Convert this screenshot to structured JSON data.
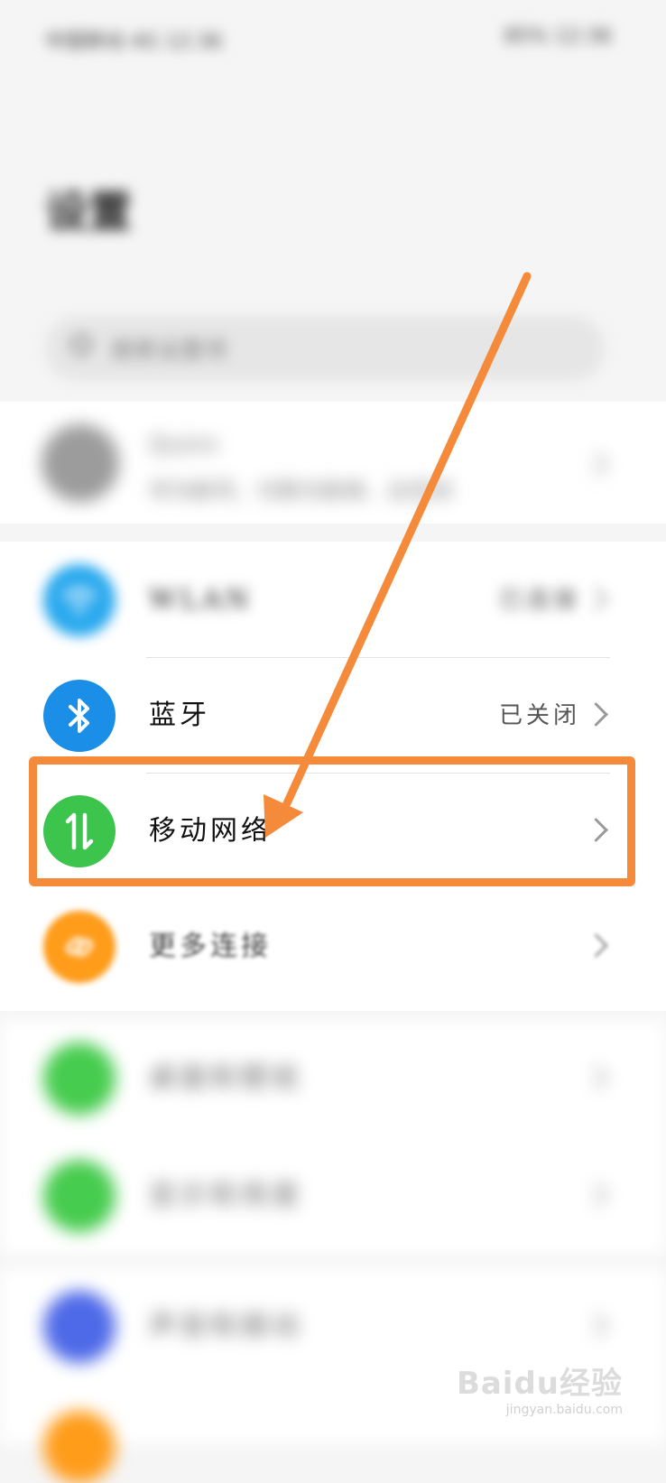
{
  "status_bar": {
    "left": "中国移动 4G 12:36",
    "right": "85% 12:36"
  },
  "page": {
    "title": "设置"
  },
  "search": {
    "placeholder": "搜索设置项"
  },
  "profile": {
    "name": "Quinn",
    "subtitle": "华为帐号、付款与账单、云空间"
  },
  "settings": {
    "wlan": {
      "label": "WLAN",
      "value": "已连接"
    },
    "bluetooth": {
      "label": "蓝牙",
      "value": "已关闭"
    },
    "mobile_network": {
      "label": "移动网络"
    },
    "more_connections": {
      "label": "更多连接"
    },
    "home_screen": {
      "label": "桌面和壁纸"
    },
    "display": {
      "label": "显示和亮度"
    },
    "sounds": {
      "label": "声音和振动"
    }
  },
  "icons": {
    "wlan": "wifi-icon",
    "bluetooth": "bluetooth-icon",
    "mobile_network": "mobile-data-icon",
    "more_connections": "link-icon",
    "search": "search-icon",
    "chevron": "chevron-right-icon"
  },
  "colors": {
    "wlan": "#2aa9ee",
    "bluetooth": "#1b8fe8",
    "mobile_network": "#3cc44c",
    "more_connections": "#ff9c1a",
    "home_screen": "#46cc4e",
    "display": "#46cc4e",
    "sounds": "#4f6ae8",
    "annotation": "#f48a3a"
  },
  "watermark": {
    "logo": "Baidu经验",
    "url": "jingyan.baidu.com"
  }
}
